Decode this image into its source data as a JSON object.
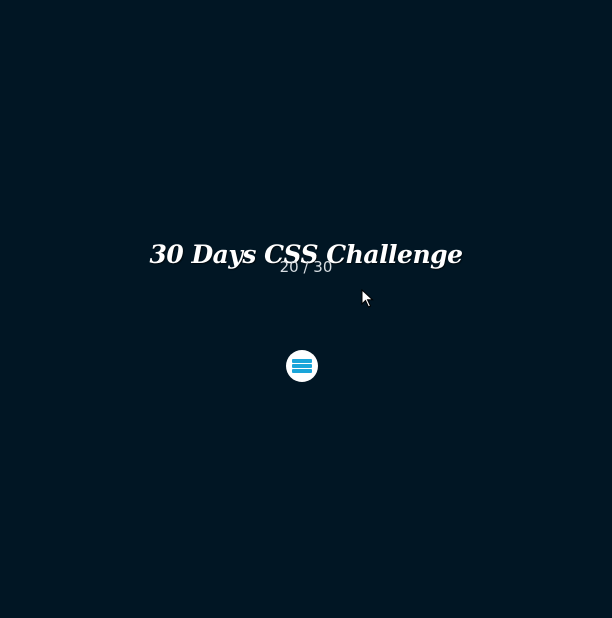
{
  "header": {
    "title": "30 Days CSS Challenge",
    "progress_text": "20 / 30"
  },
  "menu": {
    "icon": "hamburger-menu-icon",
    "icon_color": "#1aa5d9",
    "background_color": "#ffffff"
  },
  "colors": {
    "background": "#011624",
    "title": "#ffffff",
    "progress": "#d7dde2"
  }
}
